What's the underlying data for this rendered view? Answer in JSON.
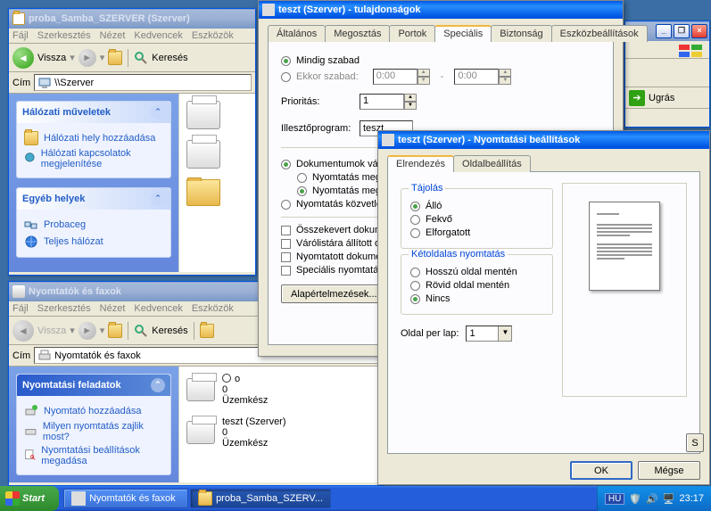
{
  "win1": {
    "title": "proba_Samba_SZERVER (Szerver)",
    "menu": [
      "Fájl",
      "Szerkesztés",
      "Nézet",
      "Kedvencek",
      "Eszközök"
    ],
    "back": "Vissza",
    "search": "Keresés",
    "addr_label": "Cím",
    "addr_value": "\\\\Szerver",
    "box1_title": "Hálózati műveletek",
    "box1_link1": "Hálózati hely hozzáadása",
    "box1_link2": "Hálózati kapcsolatok megjelenítése",
    "box2_title": "Egyéb helyek",
    "box2_link1": "Probaceg",
    "box2_link2": "Teljes hálózat"
  },
  "win2": {
    "title": "Nyomtatók és faxok",
    "menu": [
      "Fájl",
      "Szerkesztés",
      "Nézet",
      "Kedvencek",
      "Eszközök"
    ],
    "back": "Vissza",
    "search": "Keresés",
    "addr_label": "Cím",
    "addr_value": "Nyomtatók és faxok",
    "box_title": "Nyomtatási feladatok",
    "link1": "Nyomtató hozzáadása",
    "link2": "Milyen nyomtatás zajlik most?",
    "link3": "Nyomtatási beállítások megadása",
    "p1_name": "o",
    "p1_jobs": "0",
    "p1_status": "Üzemkész",
    "p2_name": "teszt (Szerver)",
    "p2_jobs": "0",
    "p2_status": "Üzemkész"
  },
  "props": {
    "title": "teszt (Szerver) - tulajdonságok",
    "tabs": [
      "Általános",
      "Megosztás",
      "Portok",
      "Speciális",
      "Biztonság",
      "Eszközbeállítások"
    ],
    "r_always": "Mindig szabad",
    "r_when": "Ekkor szabad:",
    "time1": "0:00",
    "time2": "0:00",
    "prio_label": "Prioritás:",
    "prio_value": "1",
    "driver_label": "Illesztőprogram:",
    "driver_value": "teszt",
    "r_docwait": "Dokumentumok váró",
    "r_dw1": "Nyomtatás megk",
    "r_dw2": "Nyomtatás megk",
    "r_direct": "Nyomtatás közvetlen",
    "c1": "Összekevert dokume",
    "c2": "Várólistára állított d",
    "c3": "Nyomtatott dokumen",
    "c4": "Speciális nyomtatási",
    "defaults_btn": "Alapértelmezések..."
  },
  "print": {
    "title": "teszt (Szerver) - Nyomtatási beállítások",
    "tabs": [
      "Elrendezés",
      "Oldalbeállítás"
    ],
    "grp_orient": "Tájolás",
    "o1": "Álló",
    "o2": "Fekvő",
    "o3": "Elforgatott",
    "grp_duplex": "Kétoldalas nyomtatás",
    "d1": "Hosszú oldal mentén",
    "d2": "Rövid oldal mentén",
    "d3": "Nincs",
    "ppl_label": "Oldal per lap:",
    "ppl_value": "1",
    "s_btn": "S",
    "ok": "OK",
    "cancel": "Mégse"
  },
  "far": {
    "go": "Ugrás"
  },
  "taskbar": {
    "start": "Start",
    "task1": "Nyomtatók és faxok",
    "task2": "proba_Samba_SZERV...",
    "lang": "HU",
    "clock": "23:17"
  }
}
